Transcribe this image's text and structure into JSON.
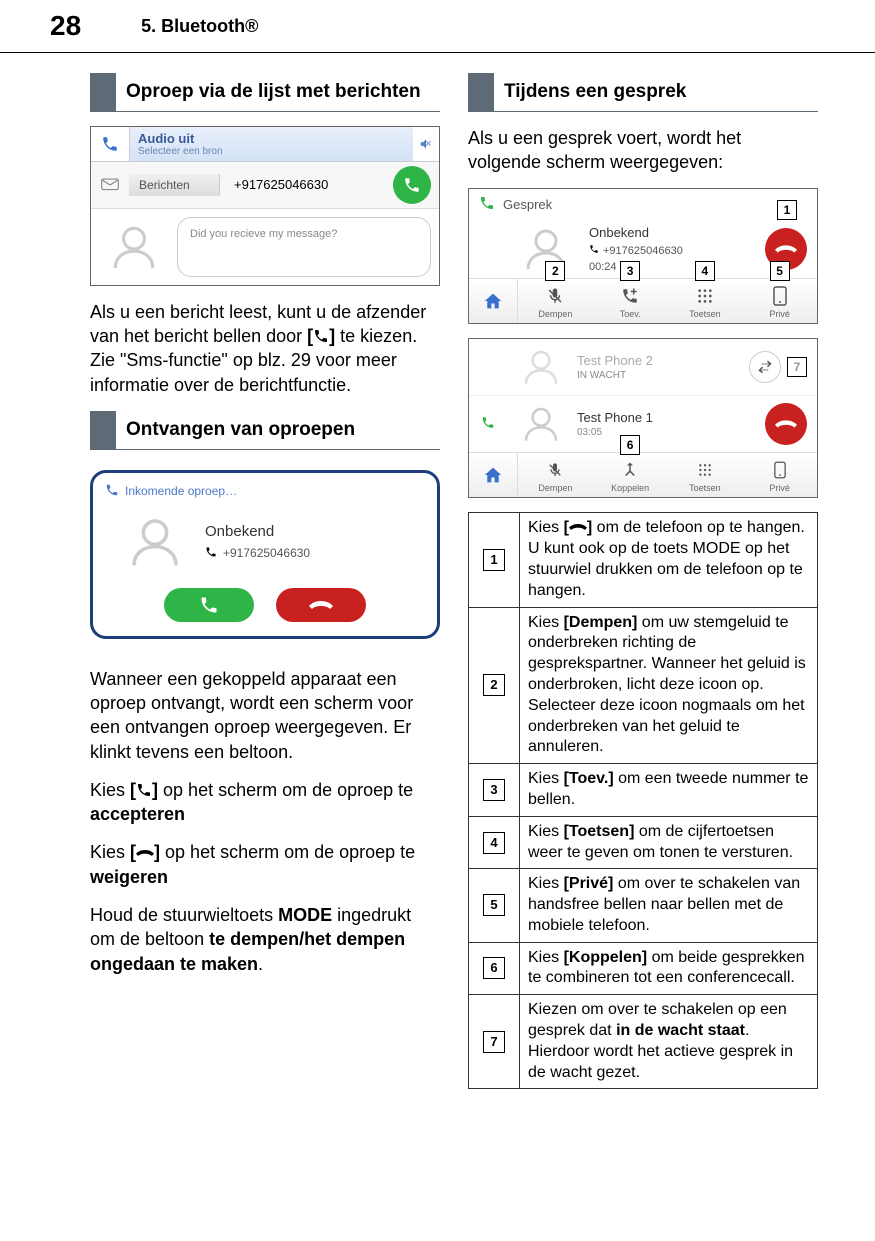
{
  "header": {
    "page_number": "28",
    "chapter": "5.   Bluetooth®"
  },
  "left": {
    "title1": "Oproep via de lijst met berichten",
    "ss1": {
      "audio_label": "Audio uit",
      "audio_sub": "Selecteer een bron",
      "berichten": "Berichten",
      "number": "+917625046630",
      "bubble": "Did you recieve my message?"
    },
    "para1_pre": "Als u een bericht leest, kunt u de afzender van het bericht bellen door ",
    "para1_bracket_open": "[",
    "para1_bracket_close": "]",
    "para1_post": " te kiezen. Zie \"Sms-functie\" op blz. 29 voor meer informatie over de berichtfunctie.",
    "title2": "Ontvangen van oproepen",
    "ss2": {
      "incoming": "Inkomende oproep…",
      "name": "Onbekend",
      "number": "+917625046630"
    },
    "para2": "Wanneer een gekoppeld apparaat een oproep ontvangt, wordt een scherm voor een ontvangen oproep weergegeven. Er klinkt tevens een beltoon.",
    "para3_pre": "Kies ",
    "para3_b1": "[",
    "para3_b2": "]",
    "para3_mid": " op het scherm om de oproep te ",
    "para3_accept": "accepteren",
    "para4_pre": "Kies ",
    "para4_b1": "[",
    "para4_b2": "]",
    "para4_mid": " op het scherm om de oproep te ",
    "para4_reject": "weigeren",
    "para5_pre": "Houd de stuurwieltoets ",
    "para5_mode": "MODE",
    "para5_mid": " ingedrukt om de beltoon ",
    "para5_bold": "te dempen/het dempen ongedaan te maken",
    "para5_dot": "."
  },
  "right": {
    "title1": "Tijdens een gesprek",
    "intro": "Als u een gesprek voert, wordt het volgende scherm weergegeven:",
    "ss3": {
      "gesprek": "Gesprek",
      "name": "Onbekend",
      "number": "+917625046630",
      "time": "00:24",
      "btn_dempen": "Dempen",
      "btn_toev": "Toev.",
      "btn_toetsen": "Toetsen",
      "btn_prive": "Privé"
    },
    "ss4": {
      "p2_name": "Test Phone 2",
      "p2_status": "IN WACHT",
      "p1_name": "Test Phone 1",
      "p1_time": "03:05",
      "btn_dempen": "Dempen",
      "btn_koppelen": "Koppelen",
      "btn_toetsen": "Toetsen",
      "btn_prive": "Privé"
    },
    "table": [
      {
        "n": "1",
        "pre": "Kies ",
        "b_open": "[",
        "b_close": "]",
        "icon": "hang",
        "post": " om de telefoon op te hangen. U kunt ook op de toets MODE op het stuurwiel drukken om de telefoon op te hangen."
      },
      {
        "n": "2",
        "pre": "Kies ",
        "bold": "[Dempen]",
        "post": " om uw stemgeluid te onderbreken richting de gesprekspartner. Wanneer het geluid is onderbroken, licht deze icoon op. Selecteer deze icoon nogmaals om het onderbreken van het geluid te annuleren."
      },
      {
        "n": "3",
        "pre": "Kies ",
        "bold": "[Toev.]",
        "post": " om een tweede nummer te bellen."
      },
      {
        "n": "4",
        "pre": "Kies ",
        "bold": "[Toetsen]",
        "post": " om de cijfertoetsen weer te geven om tonen te versturen."
      },
      {
        "n": "5",
        "pre": "Kies ",
        "bold": "[Privé]",
        "post": " om over te schakelen van handsfree bellen naar bellen met de mobiele telefoon."
      },
      {
        "n": "6",
        "pre": "Kies ",
        "bold": "[Koppelen]",
        "post": " om beide gesprekken te combineren tot een conferencecall."
      },
      {
        "n": "7",
        "pre": "Kiezen om over te schakelen op een gesprek dat ",
        "bold": "in de wacht staat",
        "post": ". Hierdoor wordt het actieve gesprek in de wacht gezet."
      }
    ]
  }
}
